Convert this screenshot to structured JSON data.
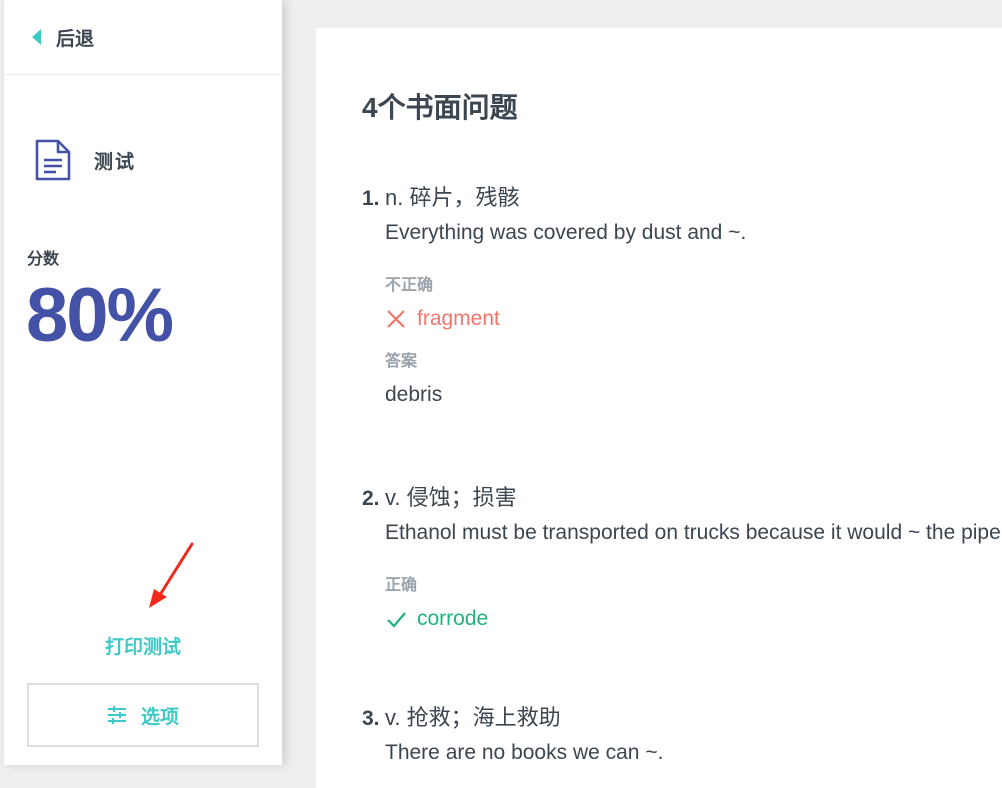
{
  "sidebar": {
    "back_label": "后退",
    "test_label": "测试",
    "score_label": "分数",
    "score_value": "80%",
    "print_label": "打印测试",
    "options_label": "选项"
  },
  "main": {
    "title": "4个书面问题",
    "questions": [
      {
        "number": "1.",
        "prompt": "n. 碎片，残骸",
        "sentence": "Everything was covered by dust and ~.",
        "status": "不正确",
        "user_answer": "fragment",
        "answer_label": "答案",
        "correct_answer": "debris"
      },
      {
        "number": "2.",
        "prompt": "v. 侵蚀；损害",
        "sentence": "Ethanol must be transported on trucks because it would ~ the pipelines.",
        "status": "正确",
        "user_answer": "corrode"
      },
      {
        "number": "3.",
        "prompt": "v. 抢救；海上救助",
        "sentence": "There are no books we can ~."
      }
    ]
  },
  "colors": {
    "accent": "#3ec9c6",
    "score": "#4352a6",
    "wrong": "#f0766a",
    "correct": "#1fb57a",
    "annotation_arrow": "#f02a1a"
  }
}
